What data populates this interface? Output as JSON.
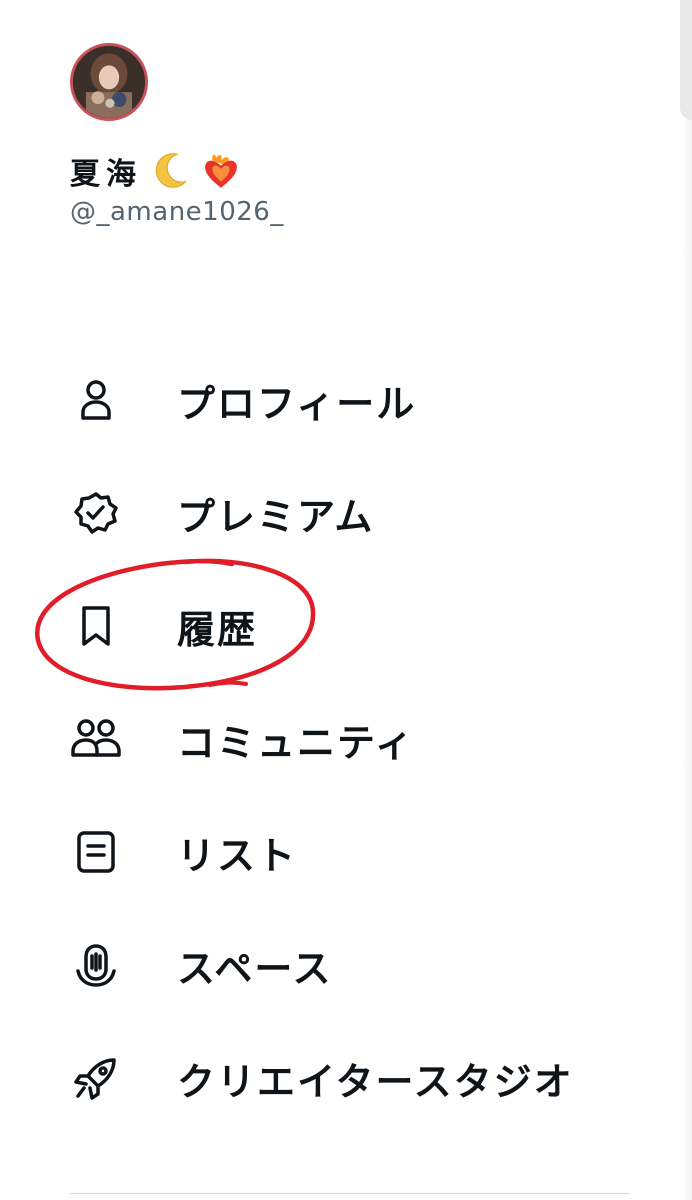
{
  "profile": {
    "display_name": "夏海",
    "emojis": [
      "crescent-moon-emoji",
      "heart-on-fire-emoji"
    ],
    "handle": "@_amane1026_"
  },
  "menu": {
    "items": [
      {
        "label": "プロフィール",
        "icon": "person-icon"
      },
      {
        "label": "プレミアム",
        "icon": "verified-badge-icon"
      },
      {
        "label": "履歴",
        "icon": "bookmark-icon"
      },
      {
        "label": "コミュニティ",
        "icon": "people-icon"
      },
      {
        "label": "リスト",
        "icon": "list-icon"
      },
      {
        "label": "スペース",
        "icon": "spaces-icon"
      },
      {
        "label": "クリエイタースタジオ",
        "icon": "rocket-icon"
      }
    ]
  },
  "annotation": {
    "color": "#e11d2a",
    "highlighted_item": "履歴"
  },
  "colors": {
    "text": "#0f1419",
    "secondary_text": "#536471",
    "divider": "#cfd9de"
  }
}
